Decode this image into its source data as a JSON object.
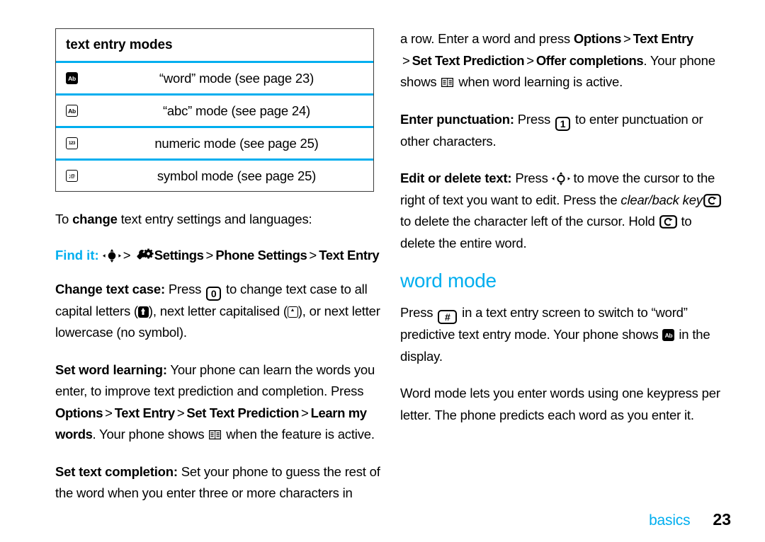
{
  "accent_color": "#00AEEF",
  "table": {
    "title": "text entry modes",
    "rows": [
      {
        "icon": "word-mode-indicator-icon",
        "icon_text": "Ab",
        "icon_style": "filled",
        "label": "“word” mode (see page 23)"
      },
      {
        "icon": "abc-mode-indicator-icon",
        "icon_text": "Ab",
        "icon_style": "outline",
        "label": "“abc” mode (see page 24)"
      },
      {
        "icon": "numeric-mode-indicator-icon",
        "icon_text": "123",
        "icon_style": "outline",
        "label": "numeric mode (see page 25)"
      },
      {
        "icon": "symbol-mode-indicator-icon",
        "icon_text": ";@",
        "icon_style": "outline",
        "label": "symbol mode (see page 25)"
      }
    ]
  },
  "left": {
    "intro_a": "To ",
    "intro_b": "change",
    "intro_c": " text entry settings and languages:",
    "find_it_label": "Find it:",
    "find_it_path": [
      "Settings",
      "Phone Settings",
      "Text Entry"
    ],
    "change_case": {
      "heading": "Change text case:",
      "t1": " Press ",
      "key": "0",
      "t2": " to change text case to all capital letters (",
      "t3": "), next letter capitalised (",
      "t4": "), or next letter lowercase (no symbol)."
    },
    "word_learning": {
      "heading": "Set word learning:",
      "t1": " Your phone can learn the words you enter, to improve text prediction and completion. Press ",
      "path": [
        "Options",
        "Text Entry",
        "Set Text Prediction",
        "Learn my words"
      ],
      "t2": ". Your phone shows ",
      "t3": " when the feature is active."
    },
    "text_completion": {
      "heading": "Set text completion:",
      "t1": " Set your phone to guess the rest of the word when you enter three or more characters in"
    }
  },
  "right": {
    "continued": {
      "t1": "a row. Enter a word and press ",
      "path": [
        "Options",
        "Text Entry",
        "Set Text Prediction",
        "Offer completions"
      ],
      "t2": ". Your phone shows ",
      "t3": " when word learning is active."
    },
    "punctuation": {
      "heading": "Enter punctuation:",
      "t1": " Press ",
      "key": "1",
      "t2": " to enter punctuation or other characters."
    },
    "edit_delete": {
      "heading": "Edit or delete text:",
      "t1": " Press ",
      "t2": " to move the cursor to the right of text you want to edit. Press the ",
      "italic": "clear/back key",
      "t3": " to delete the character left of the cursor. Hold ",
      "t4": " to delete the entire word."
    },
    "word_mode": {
      "heading": "word mode",
      "t1": "Press ",
      "key": "#",
      "t2": " in a text entry screen to switch to “word” predictive text entry mode. Your phone shows ",
      "t3": " in the display.",
      "para2": "Word mode lets you enter words using one keypress per letter. The phone predicts each word as you enter it."
    }
  },
  "footer": {
    "label": "basics",
    "page": "23"
  }
}
